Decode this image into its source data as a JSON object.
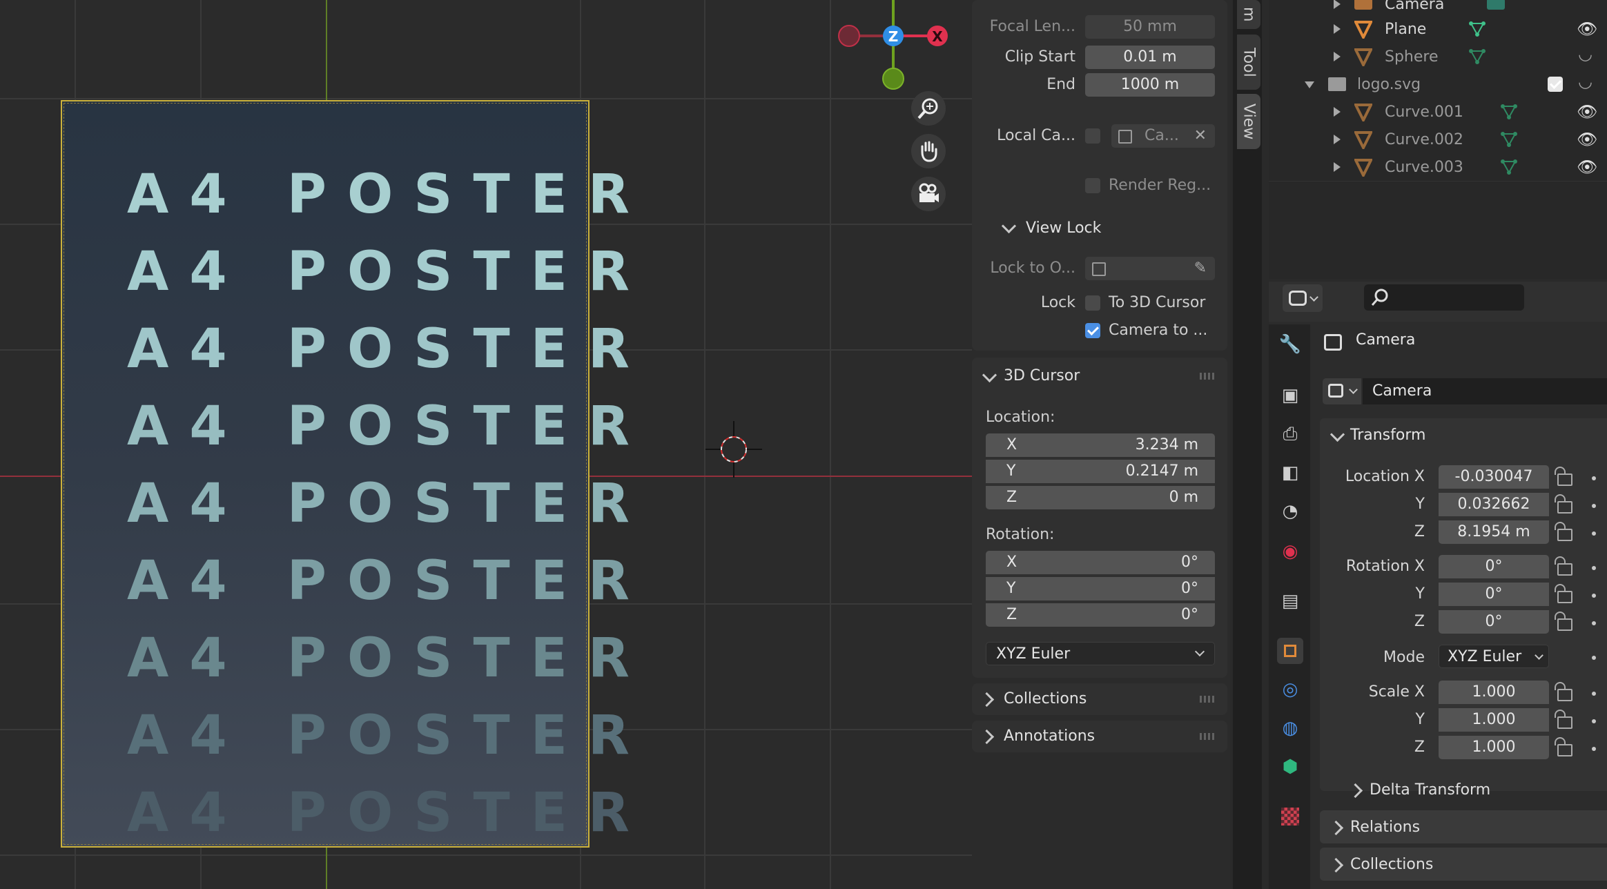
{
  "poster": {
    "lines": [
      "A4 POSTER",
      "A4 POSTER",
      "A4 POSTER",
      "A4 POSTER",
      "A4 POSTER",
      "A4 POSTER",
      "A4 POSTER",
      "A4 POSTER",
      "A4 POSTER"
    ]
  },
  "gizmo": {
    "z": "Z",
    "x": "X"
  },
  "npanel": {
    "focal_label": "Focal Len...",
    "focal_value": "50 mm",
    "clip_start_label": "Clip Start",
    "clip_start_value": "0.01 m",
    "end_label": "End",
    "end_value": "1000 m",
    "local_cam_label": "Local Ca...",
    "local_cam_value": "Ca...",
    "render_region": "Render Reg...",
    "view_lock_header": "View Lock",
    "lock_to_label": "Lock to O...",
    "lock_label": "Lock",
    "to_cursor": "To 3D Cursor",
    "camera_to": "Camera to ...",
    "cursor_header": "3D Cursor",
    "location_label": "Location:",
    "loc": [
      {
        "axis": "X",
        "value": "3.234 m"
      },
      {
        "axis": "Y",
        "value": "0.2147 m"
      },
      {
        "axis": "Z",
        "value": "0 m"
      }
    ],
    "rotation_label": "Rotation:",
    "rot": [
      {
        "axis": "X",
        "value": "0°"
      },
      {
        "axis": "Y",
        "value": "0°"
      },
      {
        "axis": "Z",
        "value": "0°"
      }
    ],
    "rot_mode": "XYZ Euler",
    "collections": "Collections",
    "annotations": "Annotations"
  },
  "tabs": {
    "tool": "Tool",
    "view": "View",
    "item": "m"
  },
  "outliner": {
    "camera": "Camera",
    "plane": "Plane",
    "sphere": "Sphere",
    "logo": "logo.svg",
    "curve1": "Curve.001",
    "curve2": "Curve.002",
    "curve3": "Curve.003"
  },
  "props": {
    "object_name": "Camera",
    "data_name": "Camera",
    "transform": "Transform",
    "loc_x_label": "Location X",
    "loc_x": "-0.030047",
    "loc_y_label": "Y",
    "loc_y": "0.032662",
    "loc_z_label": "Z",
    "loc_z": "8.1954 m",
    "rot_x_label": "Rotation X",
    "rot_x": "0°",
    "rot_y_label": "Y",
    "rot_y": "0°",
    "rot_z_label": "Z",
    "rot_z": "0°",
    "mode_label": "Mode",
    "mode": "XYZ Euler",
    "scale_x_label": "Scale X",
    "scale_x": "1.000",
    "scale_y_label": "Y",
    "scale_y": "1.000",
    "scale_z_label": "Z",
    "scale_z": "1.000",
    "delta": "Delta Transform",
    "relations": "Relations",
    "collections": "Collections"
  },
  "colors": {
    "accent": "#4a8fe4",
    "x_axis": "#e0314f",
    "y_axis": "#6ea21f",
    "z_axis": "#2f8ee6",
    "orange": "#e08a3a"
  }
}
